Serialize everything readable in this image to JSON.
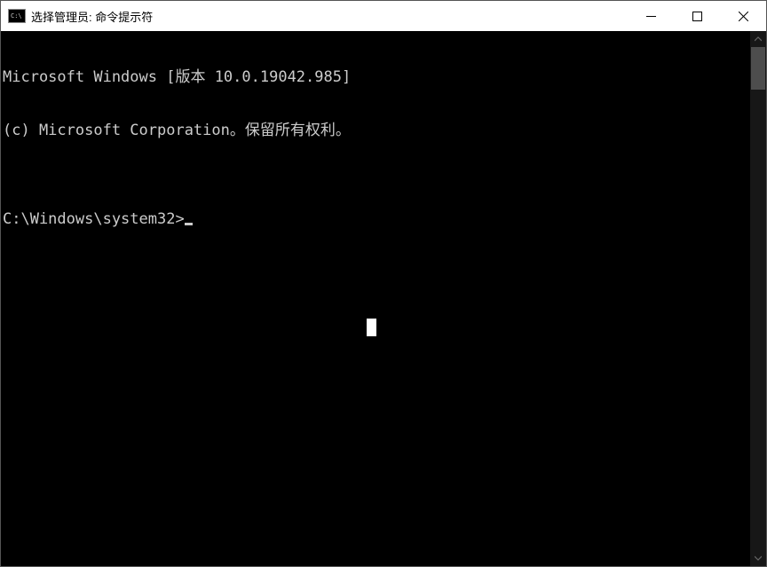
{
  "window": {
    "title": "选择管理员: 命令提示符",
    "icon_label": "C:\\"
  },
  "terminal": {
    "line1": "Microsoft Windows [版本 10.0.19042.985]",
    "line2": "(c) Microsoft Corporation。保留所有权利。",
    "blank": "",
    "prompt": "C:\\Windows\\system32>"
  }
}
